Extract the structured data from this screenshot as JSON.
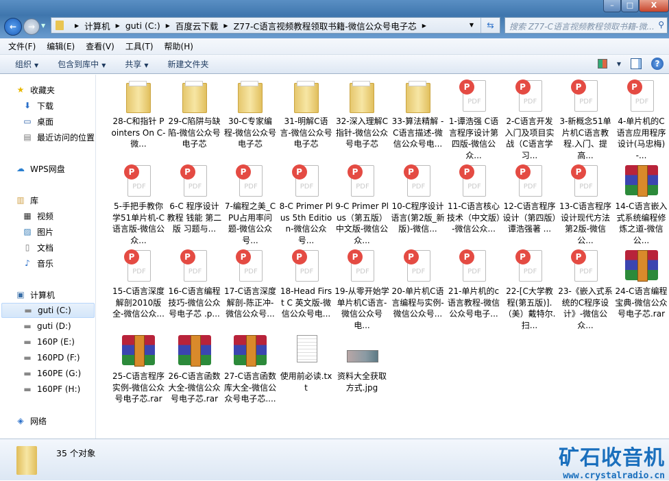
{
  "window": {
    "min": "–",
    "max": "□",
    "close": "X"
  },
  "address": {
    "crumbs": [
      "计算机",
      "guti (C:)",
      "百度云下载",
      "Z77-C语言视频教程领取书籍-微信公众号电子芯"
    ],
    "search_placeholder": "搜索 Z77-C语言视频教程领取书籍-微..."
  },
  "menu": [
    "文件(F)",
    "编辑(E)",
    "查看(V)",
    "工具(T)",
    "帮助(H)"
  ],
  "toolbar": {
    "organize": "组织",
    "include": "包含到库中",
    "share": "共享",
    "new_folder": "新建文件夹"
  },
  "sidebar": [
    {
      "label": "收藏夹",
      "icon": "star-icon",
      "glyph": "★",
      "color": "#e8b800",
      "sub": false
    },
    {
      "label": "下载",
      "icon": "download-folder-icon",
      "glyph": "⬇",
      "color": "#2a6fc9",
      "sub": true
    },
    {
      "label": "桌面",
      "icon": "desktop-icon",
      "glyph": "▭",
      "color": "#2a5fa8",
      "sub": true
    },
    {
      "label": "最近访问的位置",
      "icon": "recent-places-icon",
      "glyph": "▤",
      "color": "#777",
      "sub": true
    },
    {
      "label": "WPS网盘",
      "icon": "cloud-icon",
      "glyph": "☁",
      "color": "#2a7fd0",
      "sub": false
    },
    {
      "label": "库",
      "icon": "library-icon",
      "glyph": "▥",
      "color": "#d1a24a",
      "sub": false
    },
    {
      "label": "视频",
      "icon": "video-icon",
      "glyph": "▦",
      "color": "#333",
      "sub": true
    },
    {
      "label": "图片",
      "icon": "pictures-icon",
      "glyph": "▨",
      "color": "#3a7fb8",
      "sub": true
    },
    {
      "label": "文档",
      "icon": "documents-icon",
      "glyph": "▯",
      "color": "#777",
      "sub": true
    },
    {
      "label": "音乐",
      "icon": "music-icon",
      "glyph": "♪",
      "color": "#2a6fc9",
      "sub": true
    },
    {
      "label": "计算机",
      "icon": "computer-icon",
      "glyph": "▣",
      "color": "#3a6fa8",
      "sub": false
    },
    {
      "label": "guti (C:)",
      "icon": "drive-icon",
      "glyph": "▬",
      "color": "#888",
      "sub": true,
      "selected": true
    },
    {
      "label": "guti (D:)",
      "icon": "drive-icon",
      "glyph": "▬",
      "color": "#888",
      "sub": true
    },
    {
      "label": "160P (E:)",
      "icon": "drive-icon",
      "glyph": "▬",
      "color": "#888",
      "sub": true
    },
    {
      "label": "160PD (F:)",
      "icon": "drive-icon",
      "glyph": "▬",
      "color": "#888",
      "sub": true
    },
    {
      "label": "160PE (G:)",
      "icon": "drive-icon",
      "glyph": "▬",
      "color": "#888",
      "sub": true
    },
    {
      "label": "160PF (H:)",
      "icon": "drive-icon",
      "glyph": "▬",
      "color": "#888",
      "sub": true
    },
    {
      "label": "网络",
      "icon": "network-icon",
      "glyph": "◈",
      "color": "#2a6fc9",
      "sub": false
    }
  ],
  "files": [
    {
      "type": "folder",
      "name": "28-C和指针 Pointers On C-微..."
    },
    {
      "type": "folder",
      "name": "29-C陷阱与缺陷-微信公众号电子芯"
    },
    {
      "type": "folder",
      "name": "30-C专家编程-微信公众号电子芯"
    },
    {
      "type": "folder",
      "name": "31-明解C语言-微信公众号电子芯"
    },
    {
      "type": "folder",
      "name": "32-深入理解C指针-微信公众号电子芯"
    },
    {
      "type": "folder",
      "name": "33-算法精解 - C语言描述-微信公众号电..."
    },
    {
      "type": "pdf",
      "name": "1-谭浩强 C语言程序设计第四版-微信公众..."
    },
    {
      "type": "pdf",
      "name": "2-C语言开发入门及项目实战（C语言学习..."
    },
    {
      "type": "pdf",
      "name": "3-新概念51单片机C语言教程.入门、提高..."
    },
    {
      "type": "pdf",
      "name": "4-单片机的C语言应用程序设计(马忠梅)-..."
    },
    {
      "type": "pdf",
      "name": "5-手把手教你学51单片机-C语言版-微信公众..."
    },
    {
      "type": "pdf",
      "name": "6-C 程序设计教程 钱能 第二版 习题与..."
    },
    {
      "type": "pdf",
      "name": "7-编程之美_CPU占用率问题-微信公众号..."
    },
    {
      "type": "pdf",
      "name": "8-C Primer Plus 5th Edition-微信公众号..."
    },
    {
      "type": "pdf",
      "name": "9-C Primer Plus（第五版）中文版-微信公众..."
    },
    {
      "type": "pdf",
      "name": "10-C程序设计语言(第2版_新版)-微信..."
    },
    {
      "type": "pdf",
      "name": "11-C语言核心技术（中文版）-微信公众..."
    },
    {
      "type": "pdf",
      "name": "12-C语言程序设计（第四版）谭浩强著 ..."
    },
    {
      "type": "pdf",
      "name": "13-C语言程序设计现代方法第2版-微信公..."
    },
    {
      "type": "rar",
      "name": "14-C语言嵌入式系统编程修炼之道-微信公..."
    },
    {
      "type": "pdf",
      "name": "15-C语言深度解剖2010版全-微信公众..."
    },
    {
      "type": "pdf",
      "name": "16-C语言编程技巧-微信公众号电子芯 .p..."
    },
    {
      "type": "pdf",
      "name": "17-C语言深度解剖-陈正冲-微信公众号..."
    },
    {
      "type": "pdf",
      "name": "18-Head First C 英文版-微信公众号电..."
    },
    {
      "type": "pdf",
      "name": "19-从零开始学单片机C语言-微信公众号电..."
    },
    {
      "type": "pdf",
      "name": "20-单片机C语言编程与实例-微信公众号..."
    },
    {
      "type": "pdf",
      "name": "21-单片机的c语言教程-微信公众号电子..."
    },
    {
      "type": "pdf",
      "name": "22-[C大学教程(第五版)].（美）戴特尔.扫..."
    },
    {
      "type": "pdf",
      "name": "23-《嵌入式系统的C程序设计》-微信公众..."
    },
    {
      "type": "rar",
      "name": "24-C语言编程宝典-微信公众号电子芯.rar"
    },
    {
      "type": "rar",
      "name": "25-C语言程序实例-微信公众号电子芯.rar"
    },
    {
      "type": "rar",
      "name": "26-C语言函数大全-微信公众号电子芯.rar"
    },
    {
      "type": "rar",
      "name": "27-C语言函数库大全-微信公众号电子芯...."
    },
    {
      "type": "txt",
      "name": "使用前必读.txt"
    },
    {
      "type": "jpg",
      "name": "资料大全获取方式.jpg"
    }
  ],
  "status": {
    "count": "35 个对象"
  },
  "watermark": {
    "cn": "矿石收音机",
    "url": "www.crystalradio.cn"
  }
}
